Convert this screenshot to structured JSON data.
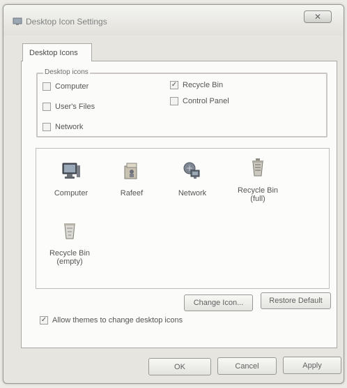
{
  "window": {
    "title": "Desktop Icon Settings",
    "close_glyph": "✕"
  },
  "tabs": [
    {
      "label": "Desktop Icons"
    }
  ],
  "desktop_icons_group": {
    "label": "Desktop icons",
    "checkboxes": [
      {
        "label": "Computer",
        "checked": false
      },
      {
        "label": "User's Files",
        "checked": false
      },
      {
        "label": "Network",
        "checked": false
      },
      {
        "label": "Recycle Bin",
        "checked": true
      },
      {
        "label": "Control Panel",
        "checked": false
      }
    ]
  },
  "icon_list": [
    {
      "label": "Computer",
      "icon": "computer-icon"
    },
    {
      "label": "Rafeef",
      "icon": "user-folder-icon"
    },
    {
      "label": "Network",
      "icon": "network-icon"
    },
    {
      "label": "Recycle Bin\n(full)",
      "icon": "recycle-bin-full-icon"
    },
    {
      "label": "Recycle Bin\n(empty)",
      "icon": "recycle-bin-empty-icon"
    }
  ],
  "buttons": {
    "change_icon": "Change Icon...",
    "restore_default": "Restore Default",
    "ok": "OK",
    "cancel": "Cancel",
    "apply": "Apply"
  },
  "allow_themes": {
    "label": "Allow themes to change desktop icons",
    "checked": true
  },
  "colors": {
    "window_bg": "#e6e5df",
    "panel_bg": "#fbfbf9",
    "text": "#555555"
  }
}
